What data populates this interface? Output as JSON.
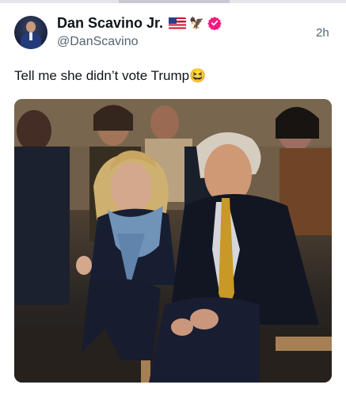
{
  "post": {
    "author": {
      "display_name": "Dan Scavino Jr.",
      "handle": "@DanScavino",
      "badges": [
        "us-flag-icon",
        "eagle-icon",
        "verified-icon"
      ],
      "verified_color": "#f91880"
    },
    "timestamp": "2h",
    "text": "Tell me she didn’t vote Trump😆",
    "media": {
      "type": "photo",
      "icon": "photo-icon"
    }
  },
  "colors": {
    "text_primary": "#0f1419",
    "text_secondary": "#536471",
    "background": "#ffffff"
  }
}
